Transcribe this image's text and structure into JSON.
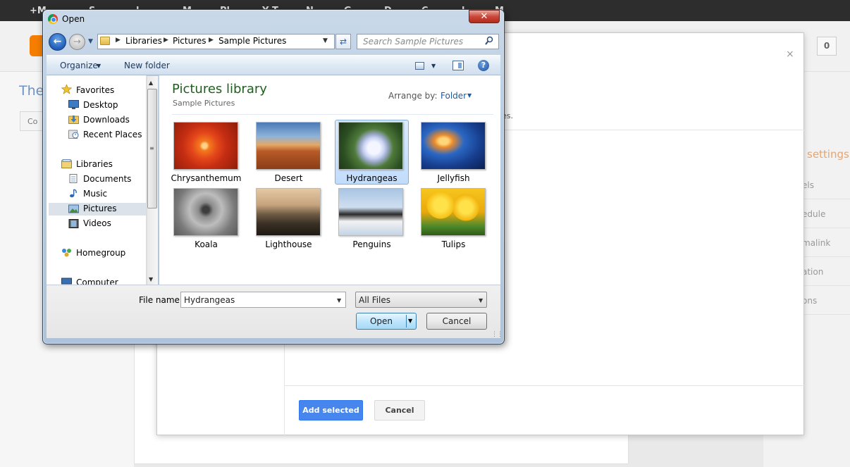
{
  "background": {
    "gbar_items": [
      "+M",
      "S",
      "l",
      "M",
      "Pl",
      "Y  T",
      "N",
      "G",
      "D",
      "C",
      "l",
      "M"
    ],
    "blog_title_fragment": "The",
    "compose_fragment": "Co",
    "count_value": "0",
    "close_glyph": "×",
    "settings_fragment": "settings",
    "sidebar_fragments": [
      "els",
      "edule",
      "malink",
      "ation",
      "ons"
    ]
  },
  "picker": {
    "close_glyph": "×",
    "note_fragment": "es.",
    "add_selected_label": "Add selected",
    "cancel_label": "Cancel"
  },
  "dialog": {
    "title": "Open",
    "close_glyph": "✕",
    "breadcrumb": [
      "Libraries",
      "Pictures",
      "Sample Pictures"
    ],
    "search_placeholder": "Search Sample Pictures",
    "toolbar": {
      "organize_label": "Organize",
      "new_folder_label": "New folder",
      "help_glyph": "?"
    },
    "nav": {
      "favorites_label": "Favorites",
      "favorites": [
        "Desktop",
        "Downloads",
        "Recent Places"
      ],
      "libraries_label": "Libraries",
      "libraries": [
        "Documents",
        "Music",
        "Pictures",
        "Videos"
      ],
      "selected": "Pictures",
      "homegroup_label": "Homegroup",
      "computer_label": "Computer"
    },
    "library": {
      "title": "Pictures library",
      "subtitle": "Sample Pictures",
      "arrange_label": "Arrange by:",
      "arrange_value": "Folder"
    },
    "files": [
      {
        "name": "Chrysanthemum",
        "thumb": "chrysanthemum-thumbnail"
      },
      {
        "name": "Desert",
        "thumb": "desert-thumbnail"
      },
      {
        "name": "Hydrangeas",
        "thumb": "hydrangeas-thumbnail"
      },
      {
        "name": "Jellyfish",
        "thumb": "jellyfish-thumbnail"
      },
      {
        "name": "Koala",
        "thumb": "koala-thumbnail"
      },
      {
        "name": "Lighthouse",
        "thumb": "lighthouse-thumbnail"
      },
      {
        "name": "Penguins",
        "thumb": "penguins-thumbnail"
      },
      {
        "name": "Tulips",
        "thumb": "tulips-thumbnail"
      }
    ],
    "selected_file": "Hydrangeas",
    "file_name_label": "File name:",
    "file_name_value": "Hydrangeas",
    "file_type_value": "All Files",
    "open_label": "Open",
    "cancel_label": "Cancel"
  },
  "colors": {
    "accent_blue": "#4787ed",
    "library_title_green": "#1e5f1e",
    "selection_blue": "#c1dcfc",
    "close_red": "#c9483a",
    "blogger_orange": "#f57d00"
  }
}
